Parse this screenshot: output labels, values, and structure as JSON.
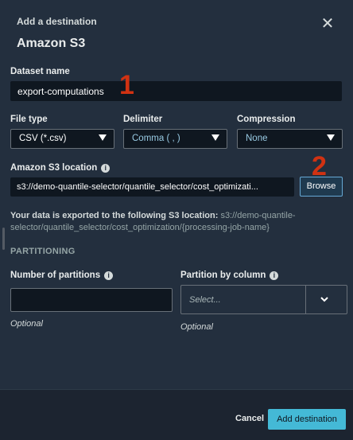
{
  "header": {
    "subtitle": "Add a destination",
    "title": "Amazon S3",
    "close_icon": "close-icon"
  },
  "fields": {
    "dataset_name": {
      "label": "Dataset name",
      "value": "export-computations"
    },
    "file_type": {
      "label": "File type",
      "value": "CSV (*.csv)"
    },
    "delimiter": {
      "label": "Delimiter",
      "value": "Comma ( , )"
    },
    "compression": {
      "label": "Compression",
      "value": "None"
    },
    "s3_location": {
      "label": "Amazon S3 location",
      "value": "s3://demo-quantile-selector/quantile_selector/cost_optimizati...",
      "browse_label": "Browse"
    }
  },
  "export_notice": {
    "prefix": "Your data is exported to the following S3 location:",
    "path": "s3://demo-quantile-selector/quantile_selector/cost_optimization/{processing-job-name}"
  },
  "partitioning": {
    "section_title": "PARTITIONING",
    "num_partitions": {
      "label": "Number of partitions",
      "value": "",
      "helper": "Optional"
    },
    "partition_by_column": {
      "label": "Partition by column",
      "placeholder": "Select...",
      "helper": "Optional"
    }
  },
  "footer": {
    "cancel_label": "Cancel",
    "primary_label": "Add destination"
  },
  "annotations": [
    "1",
    "2"
  ],
  "colors": {
    "background": "#232f3e",
    "input_bg": "#0f1720",
    "accent": "#44b9d6",
    "annotation": "#d13212"
  }
}
